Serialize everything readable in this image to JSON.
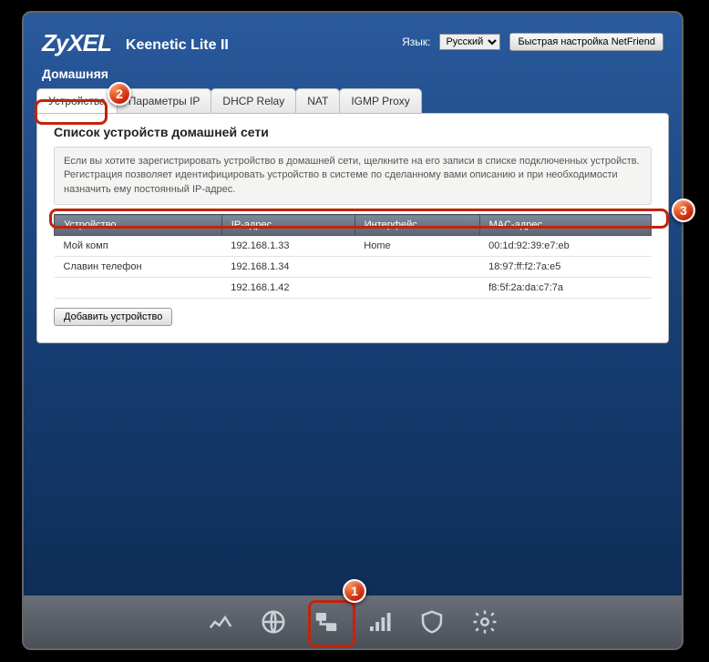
{
  "brand": "ZyXEL",
  "model": "Keenetic Lite II",
  "lang_label": "Язык:",
  "lang_value": "Русский",
  "netfriend_label": "Быстрая настройка NetFriend",
  "section_title": "Домашняя",
  "tabs": [
    {
      "label": "Устройства"
    },
    {
      "label": "Параметры IP"
    },
    {
      "label": "DHCP Relay"
    },
    {
      "label": "NAT"
    },
    {
      "label": "IGMP Proxy"
    }
  ],
  "panel": {
    "title": "Список устройств домашней сети",
    "info": "Если вы хотите зарегистрировать устройство в домашней сети, щелкните на его записи в списке подключенных устройств. Регистрация позволяет идентифицировать устройство в системе по сделанному вами описанию и при необходимости назначить ему постоянный IP-адрес.",
    "cols": {
      "device": "Устройство",
      "ip": "IP-адрес",
      "iface": "Интерфейс",
      "mac": "MAC-адрес"
    },
    "rows": [
      {
        "device": "Мой комп",
        "ip": "192.168.1.33",
        "iface": "Home",
        "mac": "00:1d:92:39:e7:eb"
      },
      {
        "device": "Славин телефон",
        "ip": "192.168.1.34",
        "iface": "",
        "mac": "18:97:ff:f2:7a:e5"
      },
      {
        "device": "",
        "ip": "192.168.1.42",
        "iface": "",
        "mac": "f8:5f:2a:da:c7:7a"
      }
    ],
    "add_button": "Добавить устройство"
  },
  "callouts": {
    "1": "1",
    "2": "2",
    "3": "3"
  }
}
